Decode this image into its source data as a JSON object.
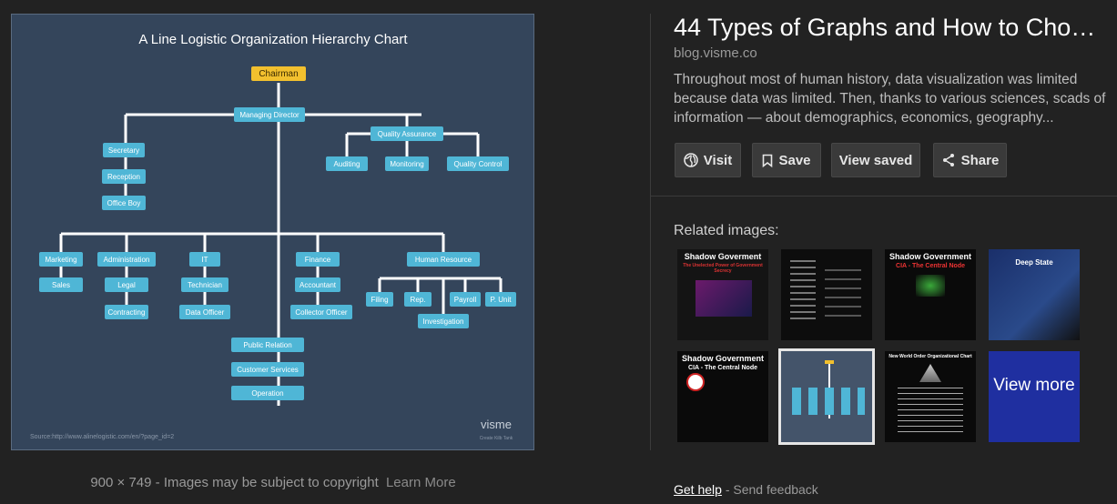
{
  "preview": {
    "chart_title": "A Line Logistic  Organization Hierarchy Chart",
    "nodes": {
      "chairman": "Chairman",
      "managing_director": "Managing Director",
      "secretary": "Secretary",
      "reception": "Reception",
      "office_boy": "Office Boy",
      "quality_assurance": "Quality Assurance",
      "auditing": "Auditing",
      "monitoring": "Monitoring",
      "quality_control": "Quality Control",
      "marketing": "Marketing",
      "sales": "Sales",
      "administration": "Administration",
      "legal": "Legal",
      "contracting": "Contracting",
      "it": "IT",
      "technician": "Technician",
      "data_officer": "Data Officer",
      "finance": "Finance",
      "accountant": "Accountant",
      "collector_officer": "Collector Officer",
      "human_resource": "Human Resource",
      "filing": "Filing",
      "rep": "Rep.",
      "payroll": "Payroll",
      "p_unit": "P. Unit",
      "investigation": "Investigation",
      "public_relation": "Public Relation",
      "customer_services": "Customer Services",
      "operation": "Operation"
    },
    "source": "Source:http://www.alinelogistic.com/en/?page_id=2",
    "brand": "visme",
    "brand_tagline": "Create Kilb Tank"
  },
  "caption": {
    "dimensions": "900 × 749",
    "separator": "-",
    "copyright": "Images may be subject to copyright",
    "learn_more": "Learn More"
  },
  "result": {
    "title": "44 Types of Graphs and How to Cho…",
    "domain": "blog.visme.co",
    "description": "Throughout most of human history, data visualization was limited because data was limited. Then, thanks to various sciences, scads of information — about demographics, economics, geography..."
  },
  "actions": {
    "visit": "Visit",
    "save": "Save",
    "view_saved": "View saved",
    "share": "Share"
  },
  "related": {
    "label": "Related images:",
    "view_more": "View more",
    "thumbs": {
      "t1_title": "Shadow Goverment",
      "t1_sub": "The Unelected Power of Government Secrecy",
      "t3_title": "Shadow Government",
      "t3_sub": "CIA - The Central Node",
      "t4_title": "Deep State",
      "t5_title": "Shadow Government",
      "t5_sub": "CIA - The Central Node",
      "t7_title": "New World Order Organizational Chart"
    }
  },
  "footer": {
    "get_help": "Get help",
    "separator": "-",
    "send_feedback": "Send feedback"
  },
  "colors": {
    "chart_bg": "#34455b",
    "node_blue": "#4fb6d6",
    "chairman_yellow": "#f2c02e",
    "page_bg": "#222222"
  }
}
